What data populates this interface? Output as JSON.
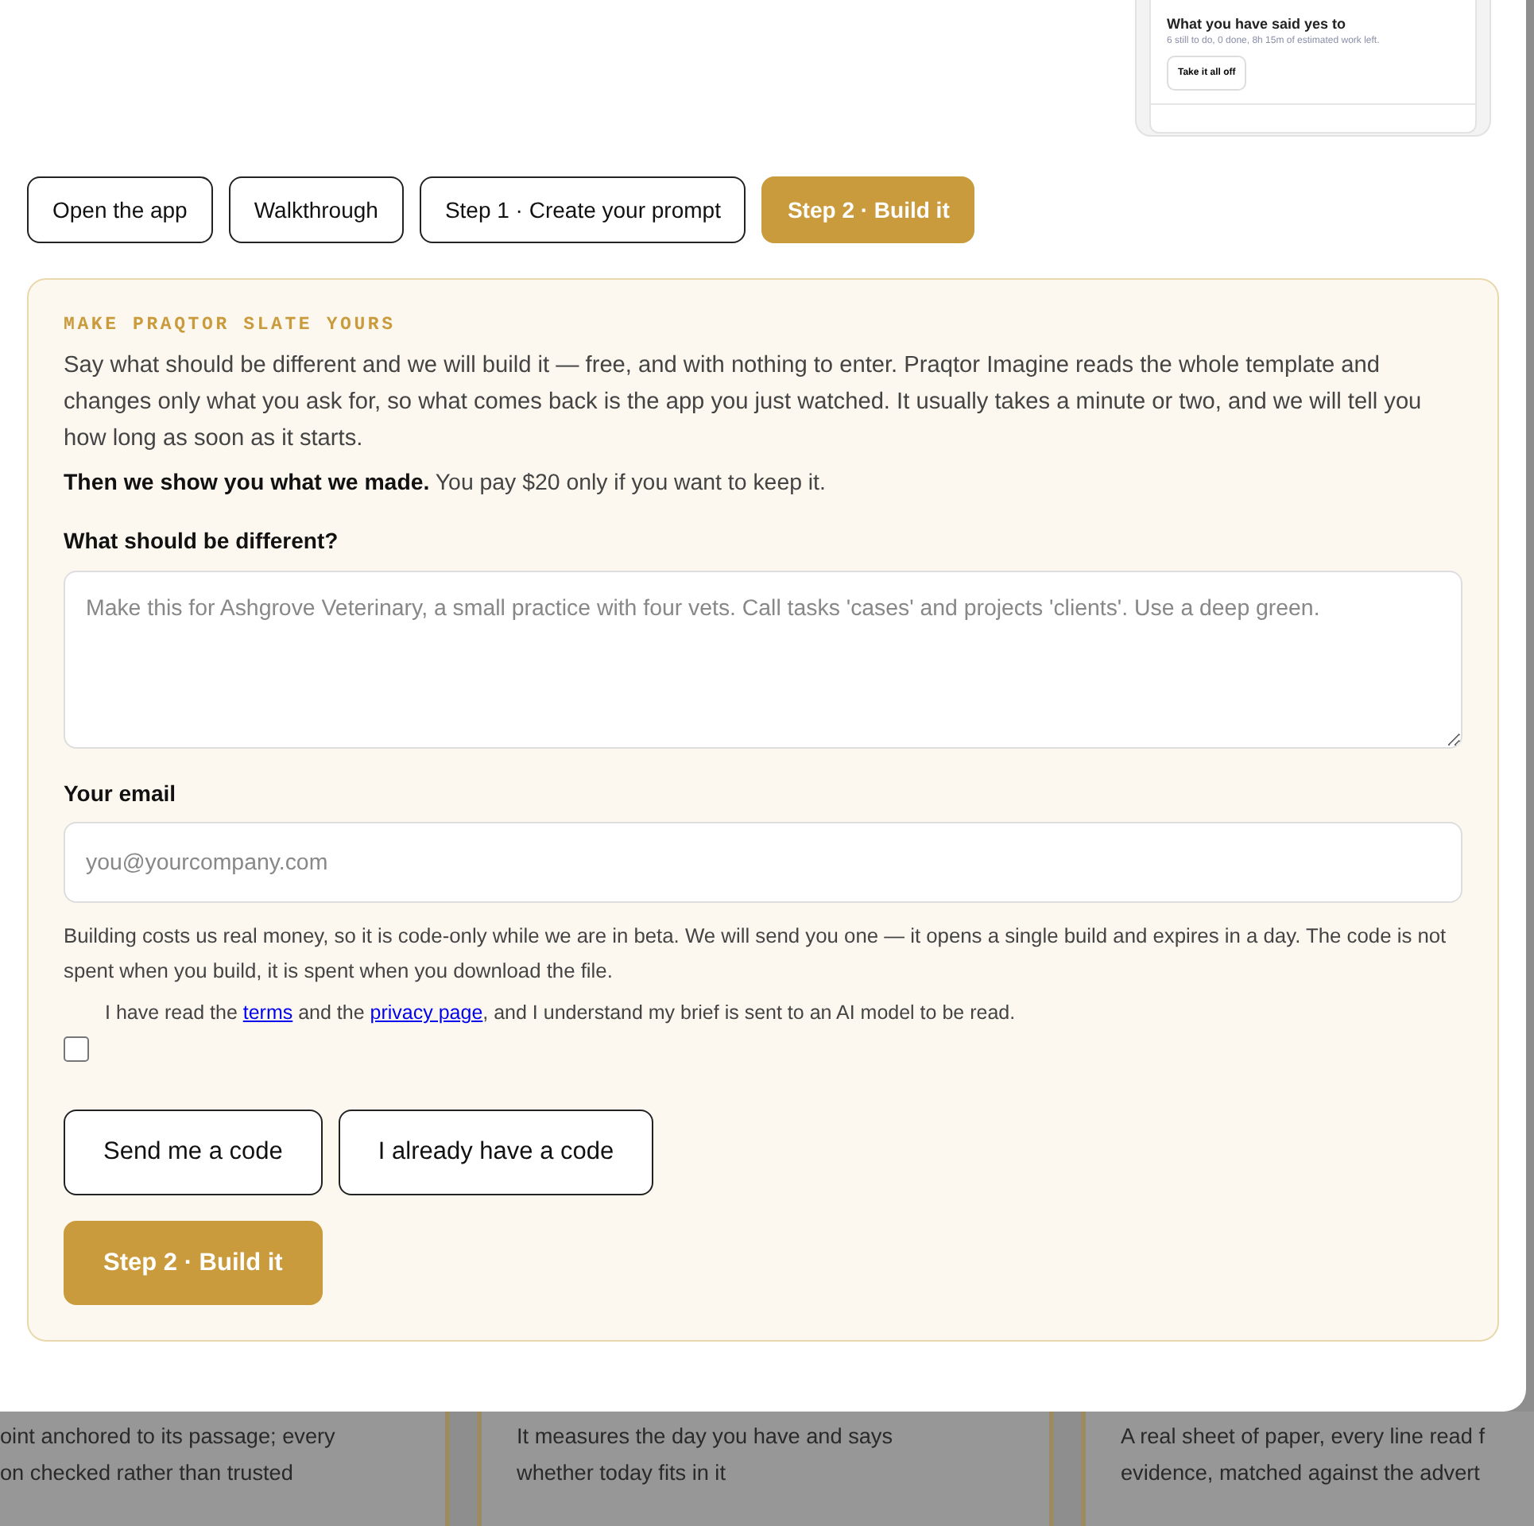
{
  "preview": {
    "title": "What you have said yes to",
    "subtitle": "6 still to do, 0 done, 8h 15m of estimated work left.",
    "button": "Take it all off"
  },
  "tabs": [
    {
      "label": "Open the app",
      "selected": false
    },
    {
      "label": "Walkthrough",
      "selected": false
    },
    {
      "label": "Step 1 · Create your prompt",
      "selected": false
    },
    {
      "label": "Step 2 · Build it",
      "selected": true
    }
  ],
  "panel": {
    "eyebrow": "MAKE PRAQTOR SLATE YOURS",
    "intro": "Say what should be different and we will build it — free, and with nothing to enter. Praqtor Imagine reads the whole template and changes only what you ask for, so what comes back is the app you just watched. It usually takes a minute or two, and we will tell you how long as soon as it starts.",
    "note": "**Then we show you what we made.** You pay $20 only if you want to keep it.",
    "brief": {
      "label": "What should be different?",
      "placeholder": "Make this for Ashgrove Veterinary, a small practice with four vets. Call tasks 'cases' and projects 'clients'. Use a deep green."
    },
    "email": {
      "label": "Your email",
      "placeholder": "you@yourcompany.com"
    },
    "code_note": "Building costs us real money, so it is code-only while we are in beta. We will send you one — it opens a single build and expires in a day. The code is not spent when you build, it is spent when you download the file.",
    "consent": {
      "checked": false,
      "parts": [
        {
          "kind": "text",
          "text": "I have read the "
        },
        {
          "kind": "link",
          "text": "terms"
        },
        {
          "kind": "text",
          "text": " and the "
        },
        {
          "kind": "link",
          "text": "privacy page"
        },
        {
          "kind": "text",
          "text": ", and I understand my brief is sent to an AI model to be read."
        }
      ]
    },
    "buttons": [
      {
        "label": "Send me a code",
        "kind": "outline"
      },
      {
        "label": "I already have a code",
        "kind": "outline"
      },
      {
        "label": "Step 2 · Build it",
        "kind": "primary"
      }
    ]
  },
  "cards": [
    {
      "lines": [
        "oint anchored to its passage; every",
        "on checked rather than trusted"
      ]
    },
    {
      "lines": [
        "It measures the day you have and says",
        "whether today fits in it"
      ]
    },
    {
      "lines": [
        "A real sheet of paper, every line read f",
        "evidence, matched against the advert"
      ]
    }
  ]
}
